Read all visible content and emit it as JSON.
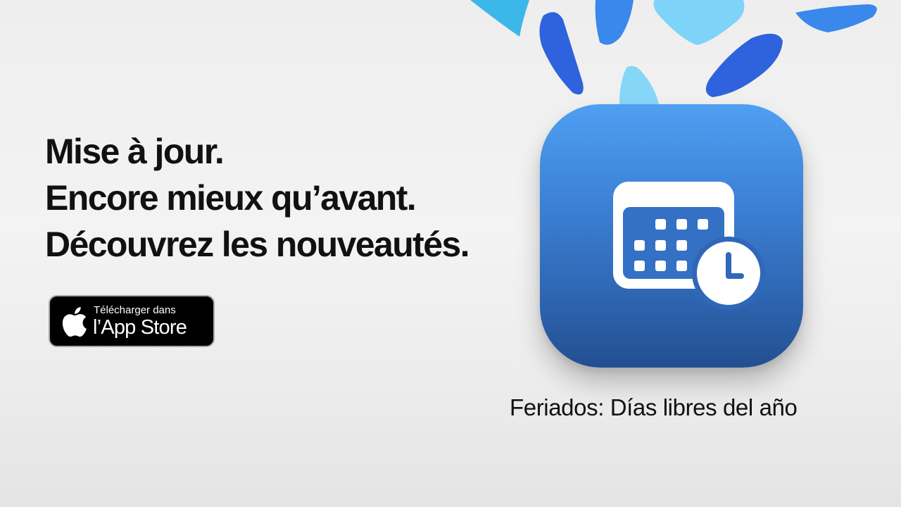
{
  "headline": {
    "line1": "Mise à jour.",
    "line2": "Encore mieux qu’avant.",
    "line3": "Découvrez les nouveautés."
  },
  "store_badge": {
    "small_label": "Télécharger dans",
    "big_label": "l’App Store"
  },
  "app": {
    "name": "Feriados: Días libres del año",
    "icon": "calendar-clock-icon"
  },
  "colors": {
    "icon_gradient_top": "#4f9ff2",
    "icon_gradient_bottom": "#234f91",
    "confetti_dark_blue": "#2f66e0",
    "confetti_light_blue": "#7fd0f7",
    "confetti_cyan": "#3fb8e8",
    "headline_text": "#111111"
  }
}
